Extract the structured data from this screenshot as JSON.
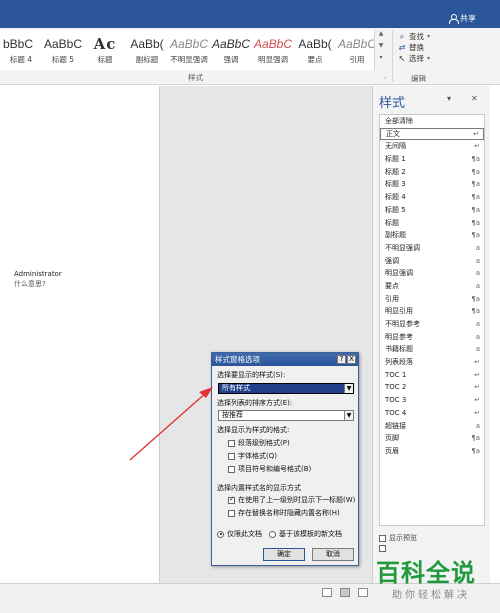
{
  "titlebar": {
    "share_label": "共享"
  },
  "ribbon": {
    "styles": [
      {
        "sample": "bBbC",
        "name": "标题 4"
      },
      {
        "sample": "AaBbC",
        "name": "标题 5"
      },
      {
        "sample": "Ac",
        "name": "标题"
      },
      {
        "sample": "AaBb(",
        "name": "副标题"
      },
      {
        "sample": "AaBbC",
        "name": "不明显强调"
      },
      {
        "sample": "AaBbC",
        "name": "强调"
      },
      {
        "sample": "AaBbC",
        "name": "明显强调"
      },
      {
        "sample": "AaBb(",
        "name": "要点"
      },
      {
        "sample": "AaBbC",
        "name": "引用"
      }
    ],
    "styles_group_label": "样式",
    "edit_group": {
      "find_label": "查找",
      "replace_label": "替换",
      "select_label": "选择",
      "group_label": "编辑"
    }
  },
  "document": {
    "comment_author": "Administrator",
    "comment_text": "什么意思?"
  },
  "styles_pane": {
    "title": "样式",
    "items": [
      {
        "label": "全部清除",
        "mark": ""
      },
      {
        "label": "正文",
        "mark": "↵"
      },
      {
        "label": "无间隔",
        "mark": "↵"
      },
      {
        "label": "标题 1",
        "mark": "¶a"
      },
      {
        "label": "标题 2",
        "mark": "¶a"
      },
      {
        "label": "标题 3",
        "mark": "¶a"
      },
      {
        "label": "标题 4",
        "mark": "¶a"
      },
      {
        "label": "标题 5",
        "mark": "¶a"
      },
      {
        "label": "标题",
        "mark": "¶a"
      },
      {
        "label": "副标题",
        "mark": "¶a"
      },
      {
        "label": "不明显强调",
        "mark": "a"
      },
      {
        "label": "强调",
        "mark": "a"
      },
      {
        "label": "明显强调",
        "mark": "a"
      },
      {
        "label": "要点",
        "mark": "a"
      },
      {
        "label": "引用",
        "mark": "¶a"
      },
      {
        "label": "明显引用",
        "mark": "¶a"
      },
      {
        "label": "不明显参考",
        "mark": "a"
      },
      {
        "label": "明显参考",
        "mark": "a"
      },
      {
        "label": "书籍标题",
        "mark": "a"
      },
      {
        "label": "列表段落",
        "mark": "↵"
      },
      {
        "label": "TOC 1",
        "mark": "↵"
      },
      {
        "label": "TOC 2",
        "mark": "↵"
      },
      {
        "label": "TOC 3",
        "mark": "↵"
      },
      {
        "label": "TOC 4",
        "mark": "↵"
      },
      {
        "label": "超链接",
        "mark": "a"
      },
      {
        "label": "页脚",
        "mark": "¶a"
      },
      {
        "label": "页眉",
        "mark": "¶a"
      }
    ],
    "show_preview_label": "显示预览"
  },
  "dialog": {
    "title": "样式窗格选项",
    "help_btn": "?",
    "close_btn": "X",
    "show_styles_label": "选择要显示的样式(S):",
    "show_styles_value": "所有样式",
    "sort_label": "选择列表的排序方式(E):",
    "sort_value": "按推荐",
    "format_label": "选择显示为样式的格式:",
    "opt_paragraph": "段落级别格式(P)",
    "opt_font": "字体格式(Q)",
    "opt_bullets": "项目符号和编号格式(B)",
    "builtin_label": "选择内置样式名的显示方式",
    "opt_next_heading": "在使用了上一级别时显示下一标题(W)",
    "opt_hide_alt": "存在替换名称时隐藏内置名称(H)",
    "radio_doc_only": "仅限此文档",
    "radio_template": "基于该模板的新文档",
    "ok_label": "确定",
    "cancel_label": "取消"
  },
  "watermark": {
    "main": "百科全说",
    "sub": "助你轻松解决"
  },
  "colors": {
    "accent": "#2b579a",
    "arrow": "#e03030",
    "watermark": "#1f9a3c"
  }
}
